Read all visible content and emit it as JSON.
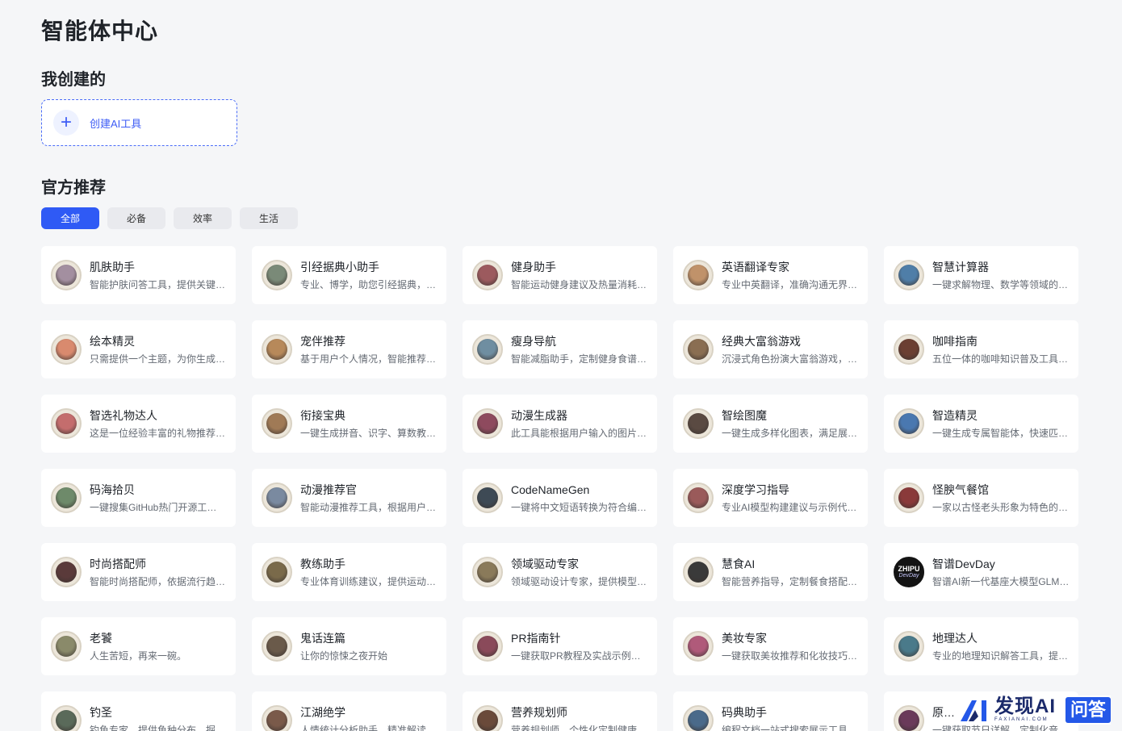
{
  "page_title": "智能体中心",
  "mine": {
    "title": "我创建的",
    "create_label": "创建AI工具"
  },
  "official": {
    "title": "官方推荐",
    "filters": [
      "全部",
      "必备",
      "效率",
      "生活"
    ],
    "active_filter": "全部"
  },
  "cards": [
    {
      "title": "肌肤助手",
      "desc": "智能护肤问答工具，提供关键…",
      "color": "#a38fa0"
    },
    {
      "title": "引经据典小助手",
      "desc": "专业、博学，助您引经据典，…",
      "color": "#7a8a78"
    },
    {
      "title": "健身助手",
      "desc": "智能运动健身建议及热量消耗…",
      "color": "#9c5a5e"
    },
    {
      "title": "英语翻译专家",
      "desc": "专业中英翻译，准确沟通无界…",
      "color": "#c0926a"
    },
    {
      "title": "智慧计算器",
      "desc": "一键求解物理、数学等领域的…",
      "color": "#4f7ea8"
    },
    {
      "title": "绘本精灵",
      "desc": "只需提供一个主题，为你生成…",
      "color": "#d98a6e"
    },
    {
      "title": "宠伴推荐",
      "desc": "基于用户个人情况，智能推荐…",
      "color": "#b7895a"
    },
    {
      "title": "瘦身导航",
      "desc": "智能减脂助手，定制健身食谱…",
      "color": "#6f8ea1"
    },
    {
      "title": "经典大富翁游戏",
      "desc": "沉浸式角色扮演大富翁游戏，…",
      "color": "#8a6e52"
    },
    {
      "title": "咖啡指南",
      "desc": "五位一体的咖啡知识普及工具…",
      "color": "#6b3f32"
    },
    {
      "title": "智选礼物达人",
      "desc": "这是一位经验丰富的礼物推荐…",
      "color": "#c46d6d"
    },
    {
      "title": "衔接宝典",
      "desc": "一键生成拼音、识字、算数教…",
      "color": "#a07a56"
    },
    {
      "title": "动漫生成器",
      "desc": "此工具能根据用户输入的图片…",
      "color": "#8e4a5e"
    },
    {
      "title": "智绘图魔",
      "desc": "一键生成多样化图表，满足展…",
      "color": "#5a4a42"
    },
    {
      "title": "智造精灵",
      "desc": "一键生成专属智能体，快速匹…",
      "color": "#4a78b0"
    },
    {
      "title": "码海拾贝",
      "desc": "一键搜集GitHub热门开源工…",
      "color": "#6e8a6a"
    },
    {
      "title": "动漫推荐官",
      "desc": "智能动漫推荐工具，根据用户…",
      "color": "#7a8aa0"
    },
    {
      "title": "CodeNameGen",
      "desc": "一键将中文短语转换为符合编…",
      "color": "#3e4a55"
    },
    {
      "title": "深度学习指导",
      "desc": "专业AI模型构建建议与示例代…",
      "color": "#9a5a5a"
    },
    {
      "title": "怪腴气餐馆",
      "desc": "一家以古怪老头形象为特色的…",
      "color": "#8a3a3a"
    },
    {
      "title": "时尚搭配师",
      "desc": "智能时尚搭配师，依据流行趋…",
      "color": "#5a3a3a"
    },
    {
      "title": "教练助手",
      "desc": "专业体育训练建议，提供运动…",
      "color": "#7a6a4a"
    },
    {
      "title": "领域驱动专家",
      "desc": "领域驱动设计专家，提供模型…",
      "color": "#8a7a5a"
    },
    {
      "title": "慧食AI",
      "desc": "智能营养指导，定制餐食搭配…",
      "color": "#3a3a3a"
    },
    {
      "title": "智谱DevDay",
      "desc": "智谱AI新一代基座大模型GLM…",
      "color": "#141414",
      "logo_line1": "ZHIPU",
      "logo_line2": "DevDay"
    },
    {
      "title": "老饕",
      "desc": "人生苦短，再来一碗。",
      "color": "#8a8a6a"
    },
    {
      "title": "鬼话连篇",
      "desc": "让你的惊悚之夜开始",
      "color": "#6a5a4a"
    },
    {
      "title": "PR指南针",
      "desc": "一键获取PR教程及实战示例的…",
      "color": "#8a4a5a"
    },
    {
      "title": "美妆专家",
      "desc": "一键获取美妆推荐和化妆技巧…",
      "color": "#b05a7a"
    },
    {
      "title": "地理达人",
      "desc": "专业的地理知识解答工具，提…",
      "color": "#4a7a8a"
    },
    {
      "title": "钓圣",
      "desc": "钓鱼专家，提供鱼种分布、掘…",
      "color": "#5a6a5a"
    },
    {
      "title": "江湖绝学",
      "desc": "人情统计分析助手，精准解读…",
      "color": "#7a5a4a"
    },
    {
      "title": "营养规划师",
      "desc": "营养规划师，个性化定制健康…",
      "color": "#6a4a3a"
    },
    {
      "title": "码典助手",
      "desc": "编程文档一站式搜索展示工具…",
      "color": "#4a6a8a"
    },
    {
      "title": "原…",
      "desc": "一键获取节日详解、定制化音…",
      "color": "#6a3a5a"
    }
  ],
  "brand": {
    "name": "发现AI",
    "sub": "FAXIANAI.COM",
    "badge": "问答",
    "colors": {
      "primary": "#2458e8",
      "dark": "#1b2a6b"
    }
  },
  "accent_color": "#2f5af5"
}
